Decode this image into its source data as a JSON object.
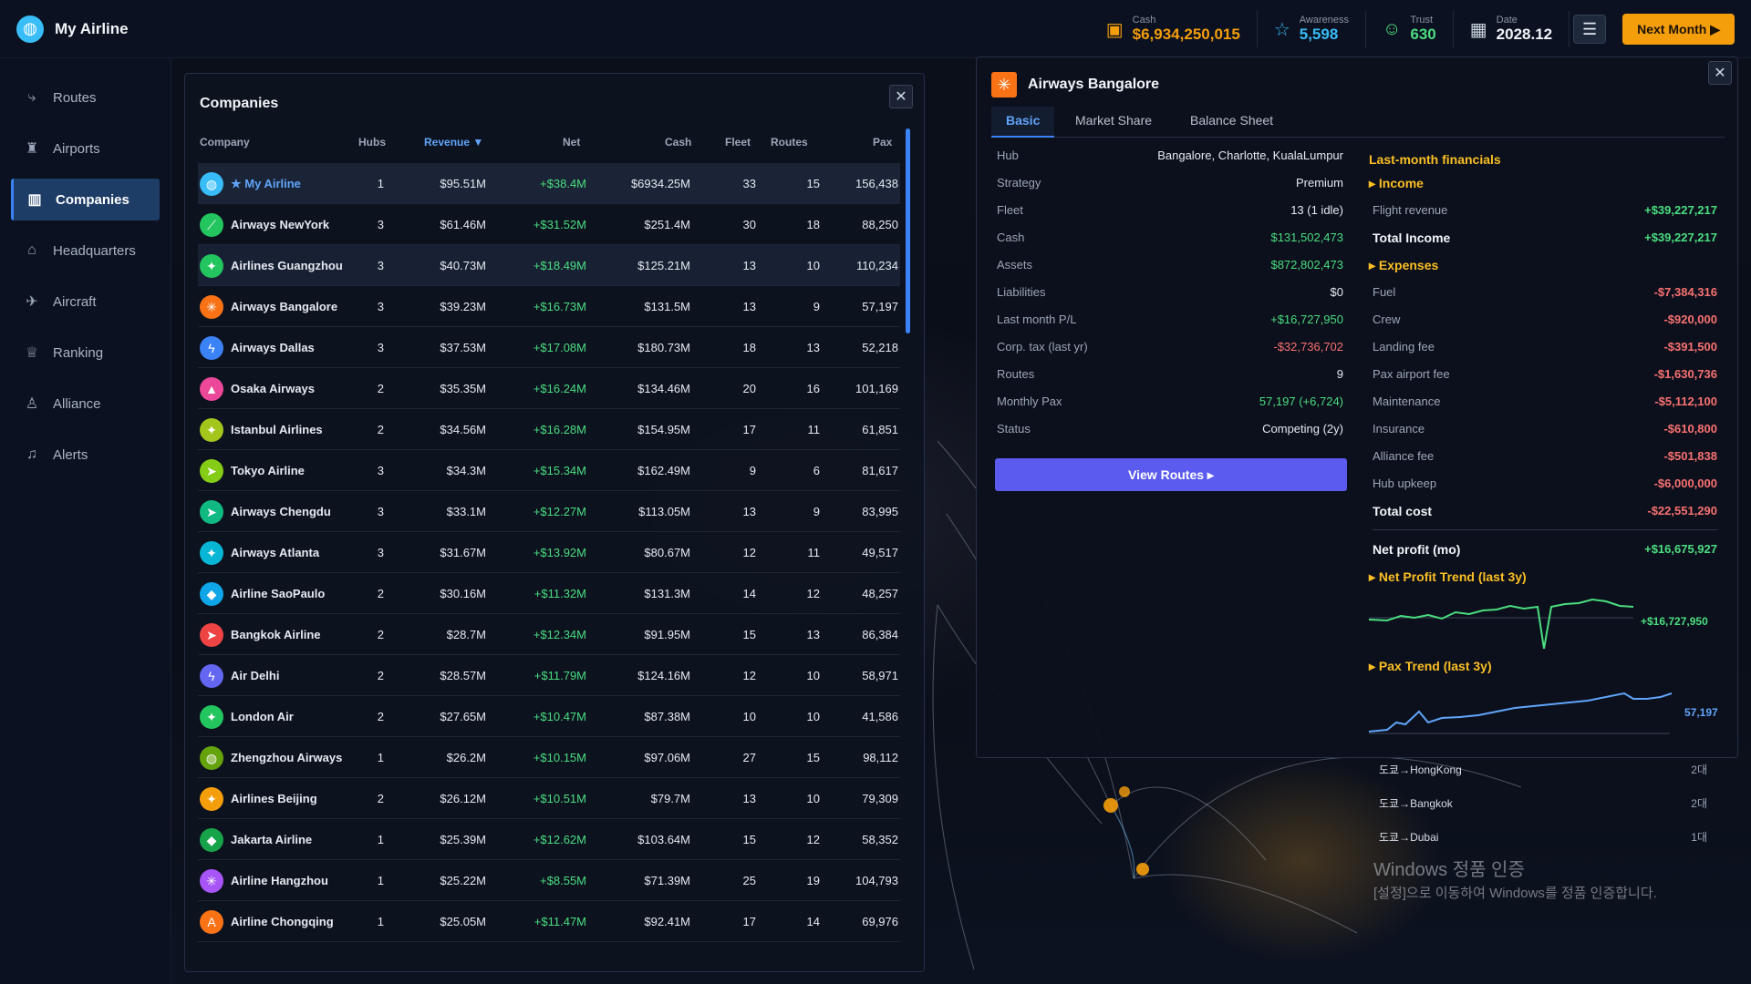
{
  "app": {
    "title": "My Airline"
  },
  "stats": {
    "cash_label": "Cash",
    "cash_value": "$6,934,250,015",
    "awareness_label": "Awareness",
    "awareness_value": "5,598",
    "trust_label": "Trust",
    "trust_value": "630",
    "date_label": "Date",
    "date_value": "2028.12",
    "next_label": "Next Month ▶"
  },
  "sidebar": {
    "items": [
      {
        "label": "Routes",
        "icon": "route-icon"
      },
      {
        "label": "Airports",
        "icon": "airport-tower-icon"
      },
      {
        "label": "Companies",
        "icon": "building-icon"
      },
      {
        "label": "Headquarters",
        "icon": "home-icon"
      },
      {
        "label": "Aircraft",
        "icon": "airplane-icon"
      },
      {
        "label": "Ranking",
        "icon": "trophy-icon"
      },
      {
        "label": "Alliance",
        "icon": "user-icon"
      },
      {
        "label": "Alerts",
        "icon": "bell-icon"
      }
    ]
  },
  "companies": {
    "title": "Companies",
    "headers": {
      "company": "Company",
      "hubs": "Hubs",
      "revenue": "Revenue ▼",
      "net": "Net",
      "cash": "Cash",
      "fleet": "Fleet",
      "routes": "Routes",
      "pax": "Pax"
    },
    "rows": [
      {
        "name": "★ My Airline",
        "hubs": "1",
        "revenue": "$95.51M",
        "net": "+$38.4M",
        "cash": "$6934.25M",
        "fleet": "33",
        "routes": "15",
        "pax": "156,438",
        "color": "#38bdf8",
        "glyph": "◍"
      },
      {
        "name": "Airways NewYork",
        "hubs": "3",
        "revenue": "$61.46M",
        "net": "+$31.52M",
        "cash": "$251.4M",
        "fleet": "30",
        "routes": "18",
        "pax": "88,250",
        "color": "#22c55e",
        "glyph": "⟋"
      },
      {
        "name": "Airlines Guangzhou",
        "hubs": "3",
        "revenue": "$40.73M",
        "net": "+$18.49M",
        "cash": "$125.21M",
        "fleet": "13",
        "routes": "10",
        "pax": "110,234",
        "color": "#22c55e",
        "glyph": "✦"
      },
      {
        "name": "Airways Bangalore",
        "hubs": "3",
        "revenue": "$39.23M",
        "net": "+$16.73M",
        "cash": "$131.5M",
        "fleet": "13",
        "routes": "9",
        "pax": "57,197",
        "color": "#f97316",
        "glyph": "✳"
      },
      {
        "name": "Airways Dallas",
        "hubs": "3",
        "revenue": "$37.53M",
        "net": "+$17.08M",
        "cash": "$180.73M",
        "fleet": "18",
        "routes": "13",
        "pax": "52,218",
        "color": "#3b82f6",
        "glyph": "ϟ"
      },
      {
        "name": "Osaka Airways",
        "hubs": "2",
        "revenue": "$35.35M",
        "net": "+$16.24M",
        "cash": "$134.46M",
        "fleet": "20",
        "routes": "16",
        "pax": "101,169",
        "color": "#ec4899",
        "glyph": "▲"
      },
      {
        "name": "Istanbul Airlines",
        "hubs": "2",
        "revenue": "$34.56M",
        "net": "+$16.28M",
        "cash": "$154.95M",
        "fleet": "17",
        "routes": "11",
        "pax": "61,851",
        "color": "#a3c61d",
        "glyph": "✦"
      },
      {
        "name": "Tokyo Airline",
        "hubs": "3",
        "revenue": "$34.3M",
        "net": "+$15.34M",
        "cash": "$162.49M",
        "fleet": "9",
        "routes": "6",
        "pax": "81,617",
        "color": "#84cc16",
        "glyph": "➤"
      },
      {
        "name": "Airways Chengdu",
        "hubs": "3",
        "revenue": "$33.1M",
        "net": "+$12.27M",
        "cash": "$113.05M",
        "fleet": "13",
        "routes": "9",
        "pax": "83,995",
        "color": "#10b981",
        "glyph": "➤"
      },
      {
        "name": "Airways Atlanta",
        "hubs": "3",
        "revenue": "$31.67M",
        "net": "+$13.92M",
        "cash": "$80.67M",
        "fleet": "12",
        "routes": "11",
        "pax": "49,517",
        "color": "#06b6d4",
        "glyph": "✦"
      },
      {
        "name": "Airline SaoPaulo",
        "hubs": "2",
        "revenue": "$30.16M",
        "net": "+$11.32M",
        "cash": "$131.3M",
        "fleet": "14",
        "routes": "12",
        "pax": "48,257",
        "color": "#0ea5e9",
        "glyph": "◆"
      },
      {
        "name": "Bangkok Airline",
        "hubs": "2",
        "revenue": "$28.7M",
        "net": "+$12.34M",
        "cash": "$91.95M",
        "fleet": "15",
        "routes": "13",
        "pax": "86,384",
        "color": "#ef4444",
        "glyph": "➤"
      },
      {
        "name": "Air Delhi",
        "hubs": "2",
        "revenue": "$28.57M",
        "net": "+$11.79M",
        "cash": "$124.16M",
        "fleet": "12",
        "routes": "10",
        "pax": "58,971",
        "color": "#6366f1",
        "glyph": "ϟ"
      },
      {
        "name": "London Air",
        "hubs": "2",
        "revenue": "$27.65M",
        "net": "+$10.47M",
        "cash": "$87.38M",
        "fleet": "10",
        "routes": "10",
        "pax": "41,586",
        "color": "#22c55e",
        "glyph": "✦"
      },
      {
        "name": "Zhengzhou Airways",
        "hubs": "1",
        "revenue": "$26.2M",
        "net": "+$10.15M",
        "cash": "$97.06M",
        "fleet": "27",
        "routes": "15",
        "pax": "98,112",
        "color": "#65a30d",
        "glyph": "◍"
      },
      {
        "name": "Airlines Beijing",
        "hubs": "2",
        "revenue": "$26.12M",
        "net": "+$10.51M",
        "cash": "$79.7M",
        "fleet": "13",
        "routes": "10",
        "pax": "79,309",
        "color": "#f59e0b",
        "glyph": "✦"
      },
      {
        "name": "Jakarta Airline",
        "hubs": "1",
        "revenue": "$25.39M",
        "net": "+$12.62M",
        "cash": "$103.64M",
        "fleet": "15",
        "routes": "12",
        "pax": "58,352",
        "color": "#16a34a",
        "glyph": "◆"
      },
      {
        "name": "Airline Hangzhou",
        "hubs": "1",
        "revenue": "$25.22M",
        "net": "+$8.55M",
        "cash": "$71.39M",
        "fleet": "25",
        "routes": "19",
        "pax": "104,793",
        "color": "#a855f7",
        "glyph": "✳"
      },
      {
        "name": "Airline Chongqing",
        "hubs": "1",
        "revenue": "$25.05M",
        "net": "+$11.47M",
        "cash": "$92.41M",
        "fleet": "17",
        "routes": "14",
        "pax": "69,976",
        "color": "#f97316",
        "glyph": "A"
      }
    ]
  },
  "detail": {
    "title": "Airways Bangalore",
    "tabs": [
      "Basic",
      "Market Share",
      "Balance Sheet"
    ],
    "basic": [
      {
        "k": "Hub",
        "v": "Bangalore, Charlotte, KualaLumpur",
        "tone": ""
      },
      {
        "k": "Strategy",
        "v": "Premium",
        "tone": ""
      },
      {
        "k": "Fleet",
        "v": "13 (1 idle)",
        "tone": ""
      },
      {
        "k": "Cash",
        "v": "$131,502,473",
        "tone": "gr"
      },
      {
        "k": "Assets",
        "v": "$872,802,473",
        "tone": "gr"
      },
      {
        "k": "Liabilities",
        "v": "$0",
        "tone": ""
      },
      {
        "k": "Last month P/L",
        "v": "+$16,727,950",
        "tone": "gr"
      },
      {
        "k": "Corp. tax (last yr)",
        "v": "-$32,736,702",
        "tone": "neg"
      },
      {
        "k": "Routes",
        "v": "9",
        "tone": ""
      },
      {
        "k": "Monthly Pax",
        "v": "57,197 (+6,724)",
        "tone": "gr"
      },
      {
        "k": "Status",
        "v": "Competing (2y)",
        "tone": ""
      }
    ],
    "view_routes": "View Routes ▸",
    "fin_title": "Last-month financials",
    "income_label": "▸ Income",
    "income": [
      {
        "k": "Flight revenue",
        "v": "+$39,227,217"
      }
    ],
    "total_income": {
      "k": "Total Income",
      "v": "+$39,227,217"
    },
    "expenses_label": "▸ Expenses",
    "expenses": [
      {
        "k": "Fuel",
        "v": "-$7,384,316"
      },
      {
        "k": "Crew",
        "v": "-$920,000"
      },
      {
        "k": "Landing fee",
        "v": "-$391,500"
      },
      {
        "k": "Pax airport fee",
        "v": "-$1,630,736"
      },
      {
        "k": "Maintenance",
        "v": "-$5,112,100"
      },
      {
        "k": "Insurance",
        "v": "-$610,800"
      },
      {
        "k": "Alliance fee",
        "v": "-$501,838"
      },
      {
        "k": "Hub upkeep",
        "v": "-$6,000,000"
      }
    ],
    "total_cost": {
      "k": "Total cost",
      "v": "-$22,551,290"
    },
    "net_profit": {
      "k": "Net profit (mo)",
      "v": "+$16,675,927"
    },
    "np_trend_label": "▸ Net Profit Trend (last 3y)",
    "np_trend_value": "+$16,727,950",
    "pax_trend_label": "▸ Pax Trend (last 3y)",
    "pax_trend_value": "57,197"
  },
  "background_list": [
    {
      "route": "도쿄→HongKong",
      "count": "2대"
    },
    {
      "route": "도쿄→Bangkok",
      "count": "2대"
    },
    {
      "route": "도쿄→Dubai",
      "count": "1대"
    }
  ],
  "watermark": {
    "line1": "Windows 정품 인증",
    "line2": "[설정]으로 이동하여 Windows를 정품 인증합니다."
  }
}
